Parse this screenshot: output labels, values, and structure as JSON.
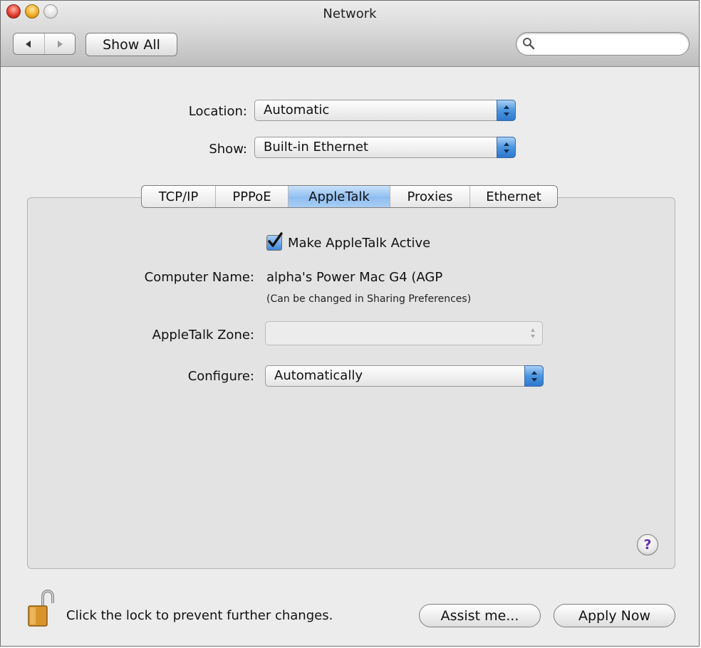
{
  "window": {
    "title": "Network"
  },
  "toolbar": {
    "back_icon": "back-arrow-icon",
    "forward_icon": "forward-arrow-icon",
    "show_all_label": "Show All",
    "search_placeholder": "",
    "search_icon": "magnifier-icon"
  },
  "location": {
    "label": "Location:",
    "value": "Automatic"
  },
  "show": {
    "label": "Show:",
    "value": "Built-in Ethernet"
  },
  "tabs": [
    {
      "label": "TCP/IP",
      "active": false
    },
    {
      "label": "PPPoE",
      "active": false
    },
    {
      "label": "AppleTalk",
      "active": true
    },
    {
      "label": "Proxies",
      "active": false
    },
    {
      "label": "Ethernet",
      "active": false
    }
  ],
  "appletalk": {
    "active_checkbox_label": "Make AppleTalk Active",
    "active_checked": true,
    "computer_name_label": "Computer Name:",
    "computer_name_value": "alpha's Power Mac G4 (AGP",
    "computer_name_note": "(Can be changed in Sharing Preferences)",
    "zone_label": "AppleTalk Zone:",
    "zone_value": "",
    "configure_label": "Configure:",
    "configure_value": "Automatically"
  },
  "help": {
    "label": "?"
  },
  "footer": {
    "lock_icon": "unlocked-padlock-icon",
    "lock_text": "Click the lock to prevent further changes.",
    "assist_label": "Assist me...",
    "apply_label": "Apply Now"
  },
  "colors": {
    "accent_blue": "#4b95e0",
    "close_red": "#e2412f",
    "minimize_yellow": "#f0b028",
    "help_purple": "#6a2bb0"
  }
}
